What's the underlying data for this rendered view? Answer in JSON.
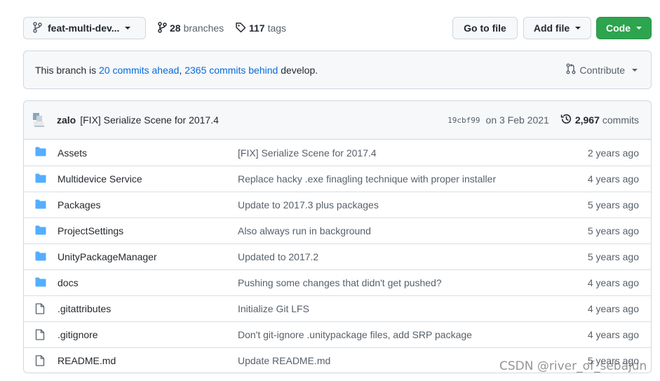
{
  "toolbar": {
    "branch_name": "feat-multi-dev...",
    "branches_count": "28",
    "branches_label": "branches",
    "tags_count": "117",
    "tags_label": "tags",
    "go_to_file_label": "Go to file",
    "add_file_label": "Add file",
    "code_label": "Code",
    "code_color": "#2da44e"
  },
  "branch_info": {
    "prefix": "This branch is ",
    "ahead_link": "20 commits ahead",
    "separator": ", ",
    "behind_link": "2365 commits behind",
    "suffix": " develop.",
    "contribute_label": "Contribute",
    "link_color": "#0969da"
  },
  "latest_commit": {
    "author": "zalo",
    "message": "[FIX] Serialize Scene for 2017.4",
    "sha": "19cbf99",
    "date": "on 3 Feb 2021",
    "commits_count": "2,967",
    "commits_label": "commits"
  },
  "files": [
    {
      "type": "folder",
      "name": "Assets",
      "message": "[FIX] Serialize Scene for 2017.4",
      "age": "2 years ago"
    },
    {
      "type": "folder",
      "name": "Multidevice Service",
      "message": "Replace hacky .exe finagling technique with proper installer",
      "age": "4 years ago"
    },
    {
      "type": "folder",
      "name": "Packages",
      "message": "Update to 2017.3 plus packages",
      "age": "5 years ago"
    },
    {
      "type": "folder",
      "name": "ProjectSettings",
      "message": "Also always run in background",
      "age": "5 years ago"
    },
    {
      "type": "folder",
      "name": "UnityPackageManager",
      "message": "Updated to 2017.2",
      "age": "5 years ago"
    },
    {
      "type": "folder",
      "name": "docs",
      "message": "Pushing some changes that didn't get pushed?",
      "age": "4 years ago"
    },
    {
      "type": "file",
      "name": ".gitattributes",
      "message": "Initialize Git LFS",
      "age": "4 years ago"
    },
    {
      "type": "file",
      "name": ".gitignore",
      "message": "Don't git-ignore .unitypackage files, add SRP package",
      "age": "4 years ago"
    },
    {
      "type": "file",
      "name": "README.md",
      "message": "Update README.md",
      "age": "5 years ago"
    }
  ],
  "icons": {
    "folder": "folder-icon",
    "file": "file-icon",
    "branch": "branch-icon",
    "tag": "tag-icon",
    "history": "history-icon",
    "contribute": "pull-request-icon"
  },
  "folder_color": "#54aeff",
  "watermark": "CSDN @river_of_sebajun"
}
